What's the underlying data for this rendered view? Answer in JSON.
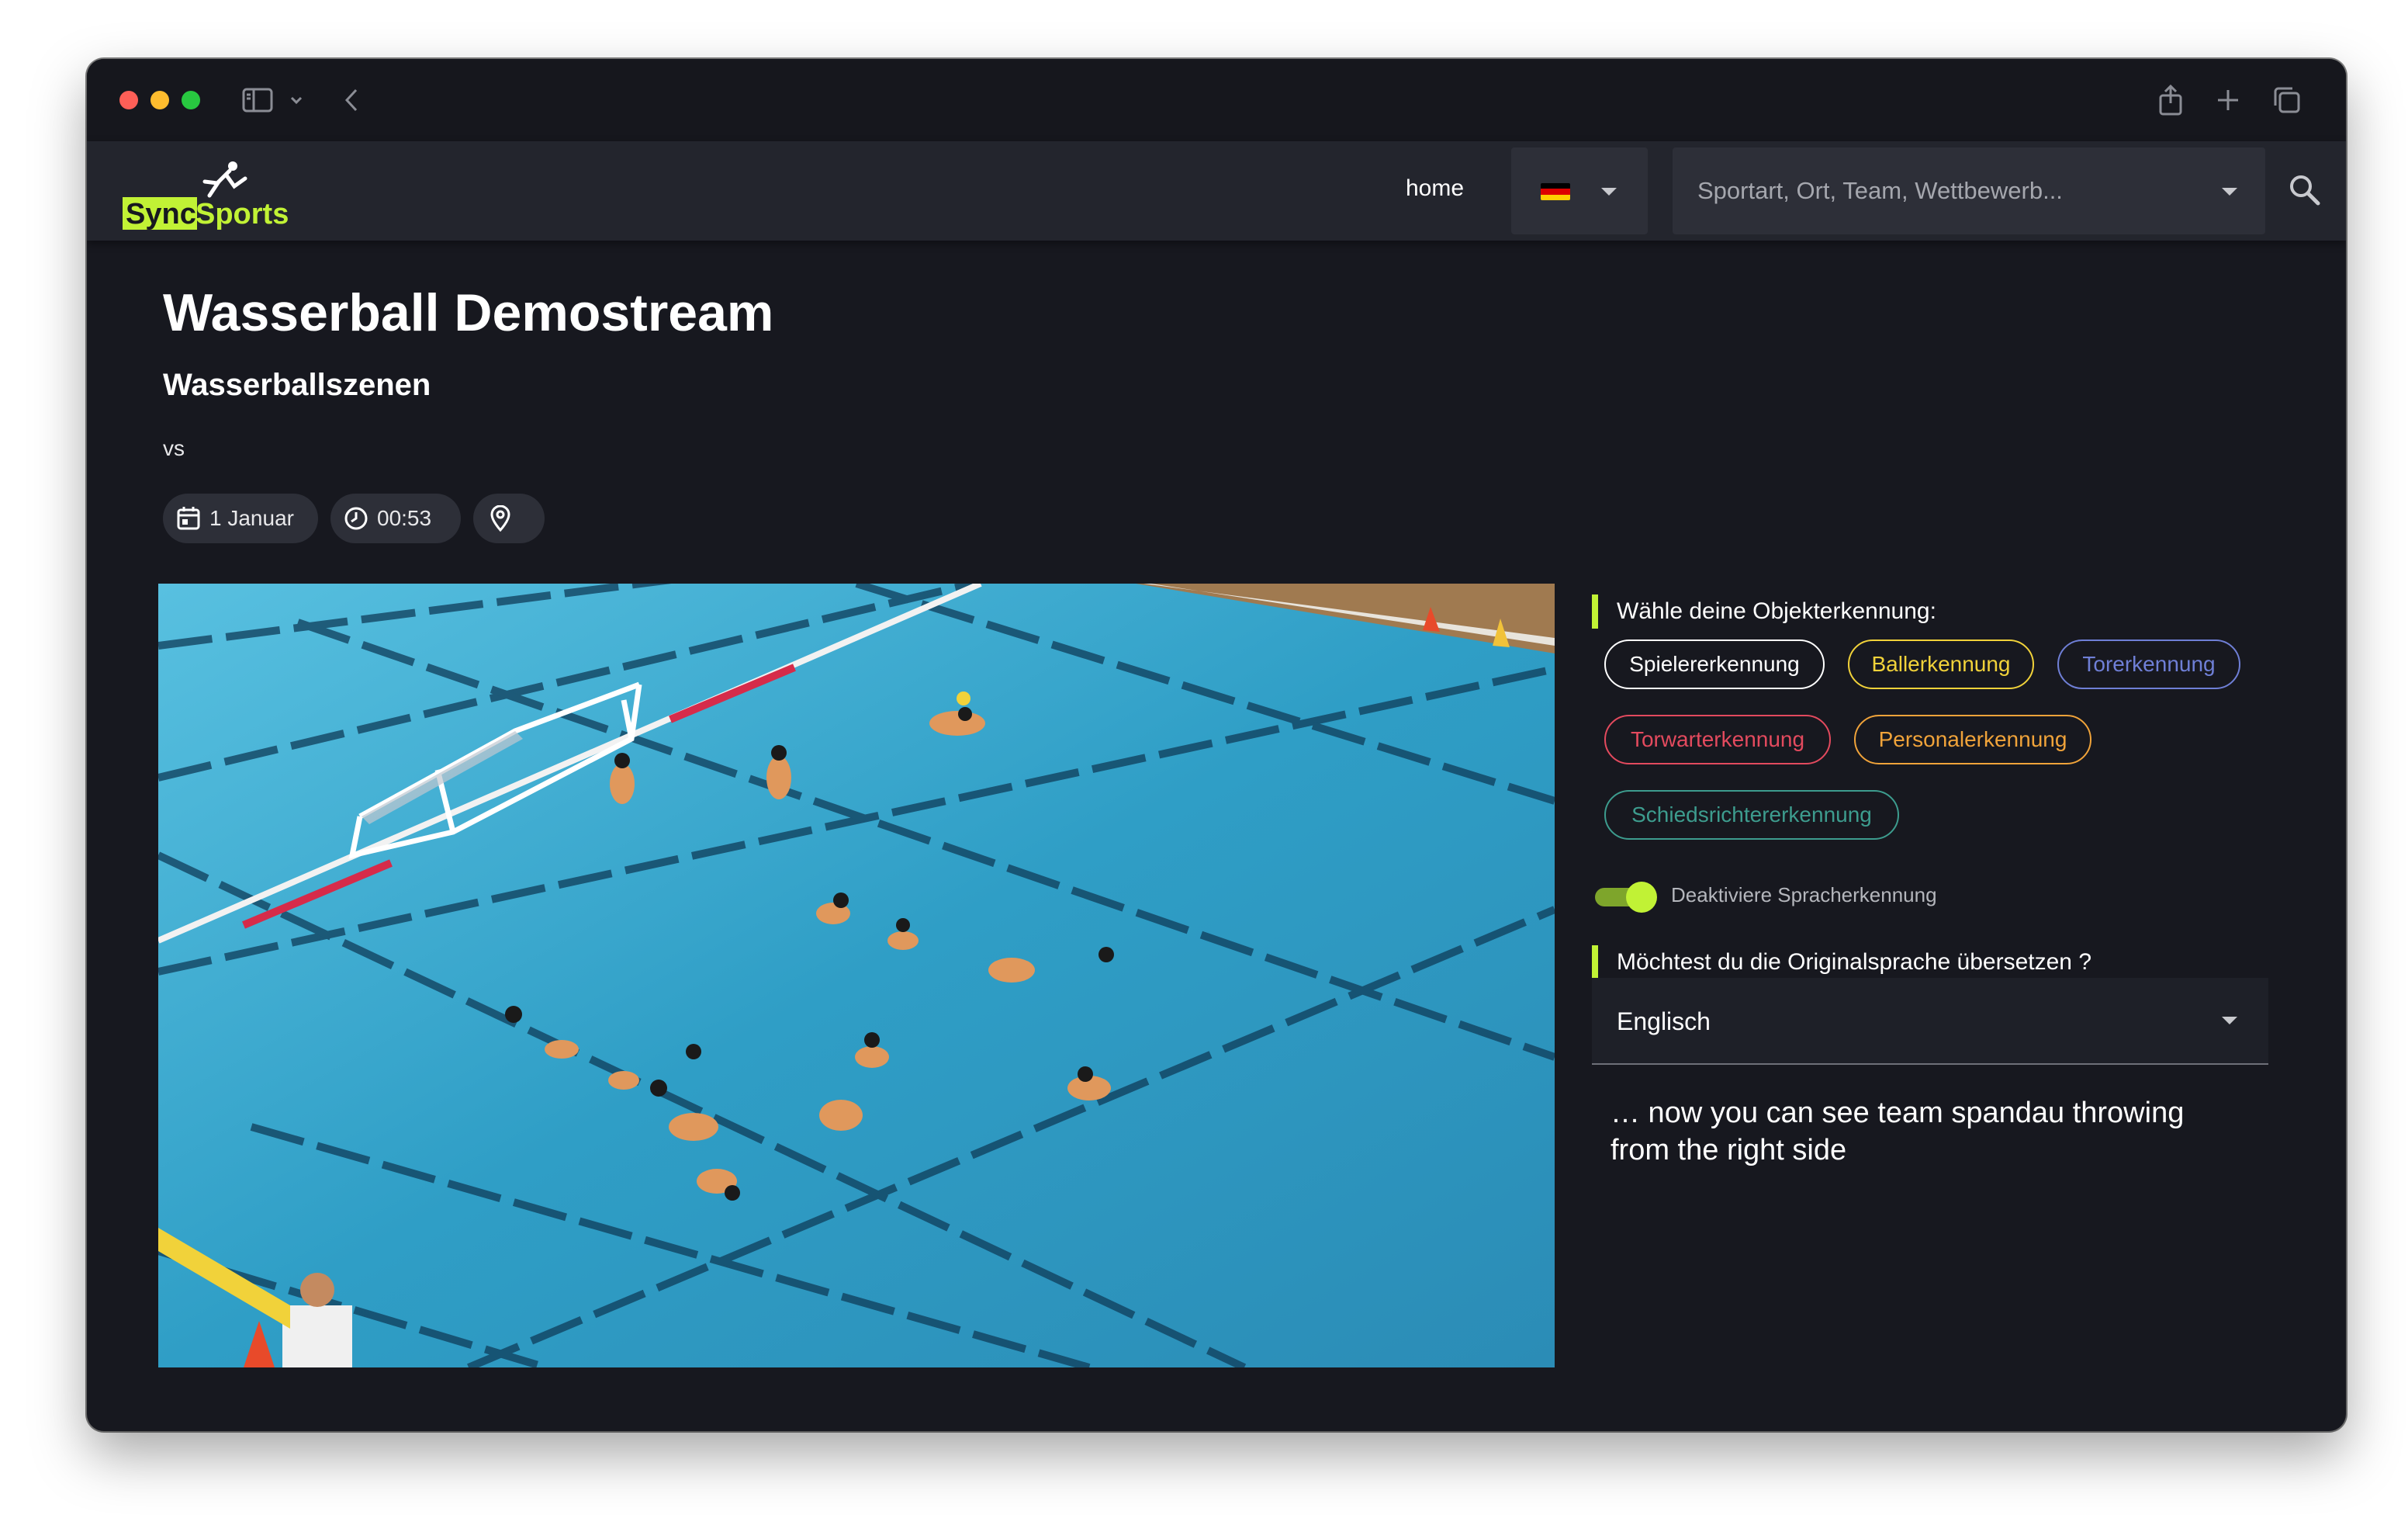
{
  "brand": {
    "logo_text_main": "Sync",
    "logo_text_accent": "Sports."
  },
  "nav": {
    "home": "home",
    "language_flag": "germany-flag",
    "search_placeholder": "Sportart, Ort, Team, Wettbewerb..."
  },
  "event": {
    "title": "Wasserball Demostream",
    "subtitle": "Wasserballszenen",
    "vs": "vs",
    "date": "1 Januar",
    "time": "00:53"
  },
  "detection": {
    "heading": "Wähle deine Objekterkennung:",
    "options": [
      {
        "label": "Spielererkennung",
        "color": "#ffffff"
      },
      {
        "label": "Ballerkennung",
        "color": "#f1d23a"
      },
      {
        "label": "Torerkennung",
        "color": "#6f7fd6"
      },
      {
        "label": "Torwarterkennung",
        "color": "#e34a5e"
      },
      {
        "label": "Personalerkennung",
        "color": "#f0a33a"
      },
      {
        "label": "Schiedsrichtererkennung",
        "color": "#3d9c8e"
      }
    ]
  },
  "speech": {
    "toggle_label": "Deaktiviere Spracherkennung",
    "toggle_on": true
  },
  "translation": {
    "heading": "Möchtest du die Originalsprache übersetzen ?",
    "selected_language": "Englisch",
    "subtitle_text": "… now you can see team spandau throwing from the right side"
  },
  "colors": {
    "accent": "#c1f235",
    "window_bg": "#17181f",
    "navbar_bg": "#23252d"
  }
}
